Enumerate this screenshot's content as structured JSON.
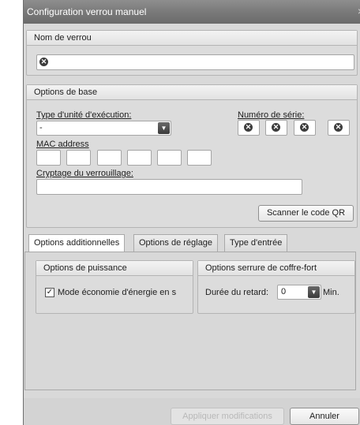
{
  "dialog": {
    "title": "Configuration verrou manuel",
    "close_glyph": "×"
  },
  "lock_name": {
    "header": "Nom de verrou",
    "clear_icon": "⊗"
  },
  "base_options": {
    "header": "Options de base",
    "exec_type_label": "Type d'unité d'exécution:",
    "exec_type_value": "-",
    "serial_label": "Numéro de série:",
    "mac_label": "MAC address",
    "encryption_label": "Cryptage du verrouillage:",
    "scan_qr_label": "Scanner le code QR"
  },
  "tabs": [
    {
      "label": "Options additionnelles",
      "active": true
    },
    {
      "label": "Options de réglage",
      "active": false
    },
    {
      "label": "Type d'entrée",
      "active": false
    }
  ],
  "power_options": {
    "header": "Options de puissance",
    "energy_saving_label": "Mode économie d'énergie en s",
    "energy_saving_checked": true
  },
  "safe_options": {
    "header": "Options serrure de coffre-fort",
    "delay_label": "Durée du retard:",
    "delay_value": "0",
    "unit": "Min."
  },
  "footer": {
    "apply_label": "Appliquer modifications",
    "cancel_label": "Annuler"
  },
  "icons": {
    "clear": "clear-circle-x-icon",
    "dropdown": "dropdown-arrow-icon",
    "checkbox": "checkmark-icon"
  }
}
